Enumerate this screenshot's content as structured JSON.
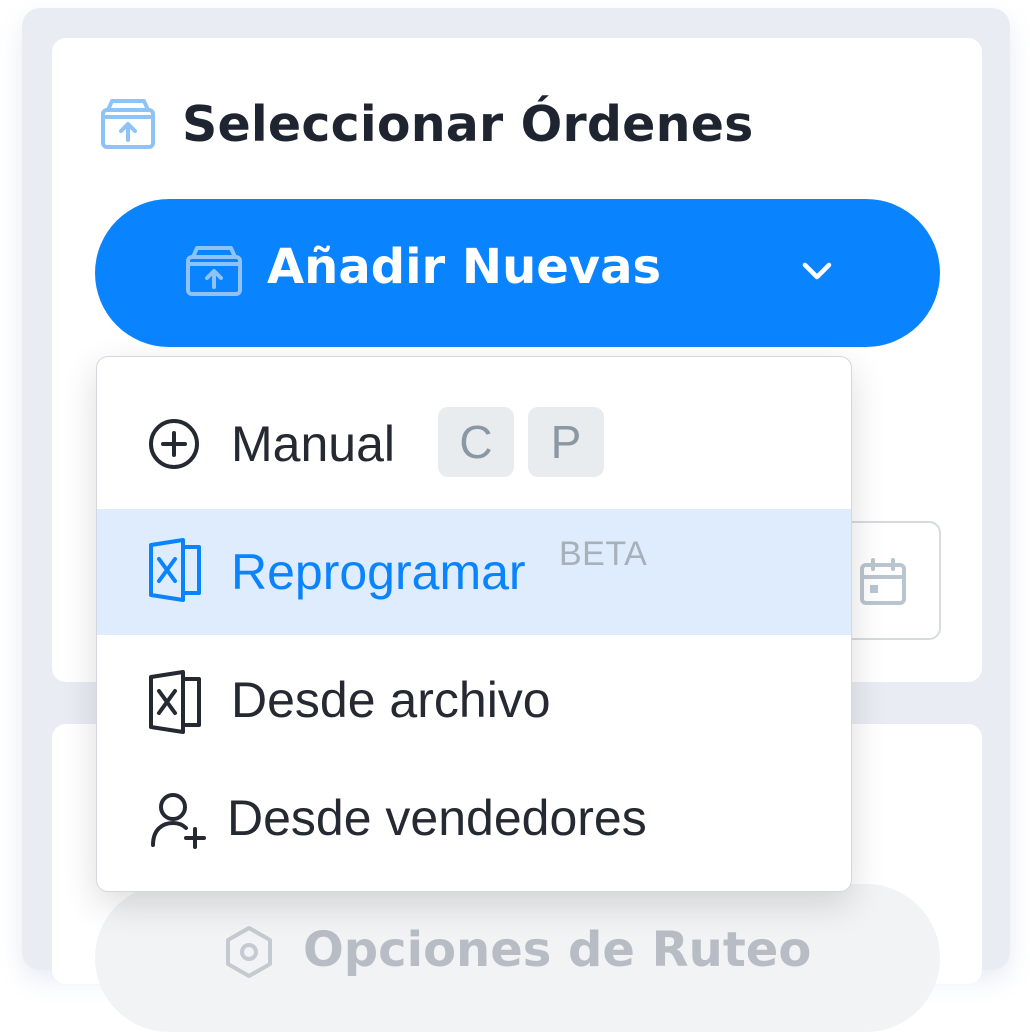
{
  "header": {
    "title": "Seleccionar Órdenes",
    "icon": "archive-upload-icon"
  },
  "add_button": {
    "label": "Añadir Nuevas",
    "icon": "archive-upload-icon",
    "caret": "chevron-down-icon"
  },
  "menu": {
    "items": [
      {
        "label": "Manual",
        "icon": "plus-circle-icon",
        "shortcuts": [
          "C",
          "P"
        ]
      },
      {
        "label": "Reprogramar",
        "icon": "excel-file-icon",
        "badge": "BETA",
        "highlighted": true
      },
      {
        "label": "Desde archivo",
        "icon": "excel-file-icon"
      },
      {
        "label": "Desde vendedores",
        "icon": "user-plus-icon"
      }
    ]
  },
  "routing_button": {
    "label": "Opciones de Ruteo",
    "icon": "settings-hex-icon"
  },
  "colors": {
    "primary": "#0a84fe",
    "highlight": "#deecfd",
    "text_dark": "#1f2530",
    "frame_bg": "#e9edf3"
  }
}
